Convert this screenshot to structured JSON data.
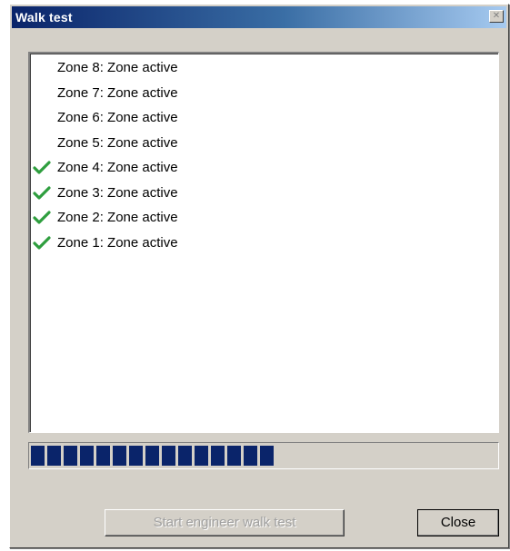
{
  "window": {
    "title": "Walk test",
    "close_glyph": "✕"
  },
  "zones": [
    {
      "label": "Zone 8: Zone active",
      "tested": false
    },
    {
      "label": "Zone 7: Zone active",
      "tested": false
    },
    {
      "label": "Zone 6: Zone active",
      "tested": false
    },
    {
      "label": "Zone 5: Zone active",
      "tested": false
    },
    {
      "label": "Zone 4: Zone active",
      "tested": true
    },
    {
      "label": "Zone 3: Zone active",
      "tested": true
    },
    {
      "label": "Zone 2: Zone active",
      "tested": true
    },
    {
      "label": "Zone 1: Zone active",
      "tested": true
    }
  ],
  "progress": {
    "fraction": 0.52,
    "color": "#0a246a"
  },
  "buttons": {
    "start_label": "Start engineer walk test",
    "start_enabled": false,
    "close_label": "Close"
  },
  "icons": {
    "tested_marker": "check-icon",
    "check_color": "#2e9e3e"
  }
}
